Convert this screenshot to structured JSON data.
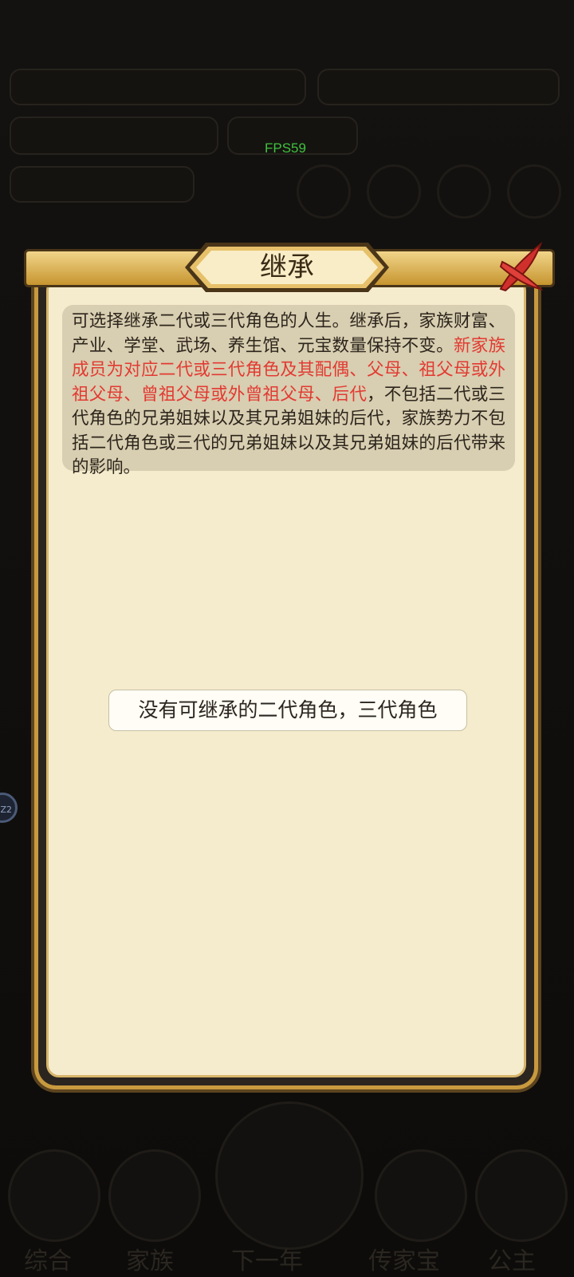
{
  "fps_label": "FPS59",
  "side_badge": "Z2",
  "dialog": {
    "title": "继承",
    "info_lead": "可选择继承二代或三代角色的人生。继承后，家族财富、产业、学堂、武场、养生馆、元宝数量保持不变。",
    "info_highlight": "新家族成员为对应二代或三代角色及其配偶、父母、祖父母或外祖父母、曾祖父母或外曾祖父母、后代",
    "info_tail": "，不包括二代或三代角色的兄弟姐妹以及其兄弟姐妹的后代，家族势力不包括二代角色或三代的兄弟姐妹以及其兄弟姐妹的后代带来的影响。",
    "empty_message": "没有可继承的二代角色，三代角色"
  },
  "colors": {
    "highlight": "#e23a32",
    "panel": "#f5ecce",
    "fps": "#3fc23f"
  },
  "background": {
    "bottom_nav": [
      "综合",
      "家族",
      "下一年",
      "传家宝",
      "公主"
    ]
  }
}
